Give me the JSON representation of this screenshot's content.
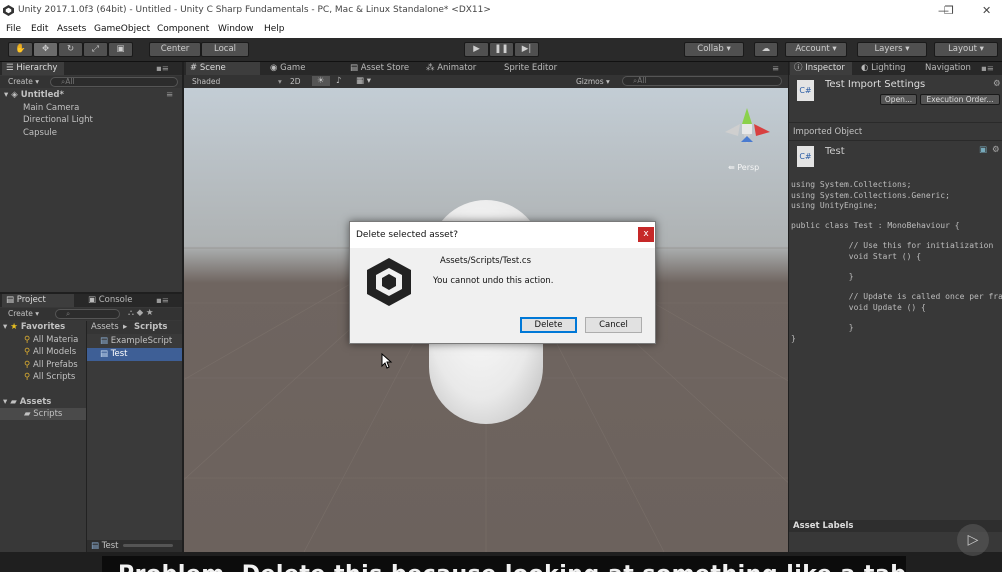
{
  "window": {
    "title": "Unity 2017.1.0f3 (64bit) - Untitled - Unity C Sharp Fundamentals - PC, Mac & Linux Standalone* <DX11>",
    "controls": [
      "—",
      "❐",
      "✕"
    ]
  },
  "menu": [
    "File",
    "Edit",
    "Assets",
    "GameObject",
    "Component",
    "Window",
    "Help"
  ],
  "toolbar": {
    "pivot": "Center",
    "space": "Local",
    "collab": "Collab ▾",
    "account": "Account",
    "layers": "Layers",
    "layout": "Layout"
  },
  "hierarchy": {
    "tab": "Hierarchy",
    "create": "Create ▾",
    "search_placeholder": "All",
    "scene": "Untitled*",
    "items": [
      "Main Camera",
      "Directional Light",
      "Capsule"
    ]
  },
  "scene_tabs": [
    "Scene",
    "Game",
    "Asset Store",
    "Animator",
    "Sprite Editor"
  ],
  "scene_toolbar": {
    "shading": "Shaded",
    "mode": "2D",
    "gizmos": "Gizmos ▾",
    "search_placeholder": "All",
    "persp": "Persp"
  },
  "project": {
    "tabs": [
      "Project",
      "Console"
    ],
    "create": "Create ▾",
    "favorites": "Favorites",
    "favorite_items": [
      "All Materia",
      "All Models",
      "All Prefabs",
      "All Scripts"
    ],
    "assets_root": "Assets",
    "assets_children": [
      "Scripts"
    ],
    "breadcrumb": [
      "Assets",
      "Scripts"
    ],
    "files": [
      "ExampleScript",
      "Test"
    ],
    "footer": "Test"
  },
  "inspector": {
    "tabs": [
      "Inspector",
      "Lighting",
      "Navigation"
    ],
    "title": "Test Import Settings",
    "open_btn": "Open...",
    "exec_btn": "Execution Order...",
    "section": "Imported Object",
    "object_name": "Test",
    "code": [
      "using System.Collections;",
      "using System.Collections.Generic;",
      "using UnityEngine;",
      "",
      "public class Test : MonoBehaviour {",
      "",
      "            // Use this for initialization",
      "            void Start () {",
      "",
      "            }",
      "",
      "            // Update is called once per frame",
      "            void Update () {",
      "",
      "            }",
      "}"
    ],
    "asset_labels": "Asset Labels"
  },
  "dialog": {
    "title": "Delete selected asset?",
    "close": "x",
    "path": "Assets/Scripts/Test.cs",
    "message": "You cannot undo this action.",
    "delete": "Delete",
    "cancel": "Cancel"
  },
  "subtitle": "Problem. Delete this because looking at something like a table"
}
